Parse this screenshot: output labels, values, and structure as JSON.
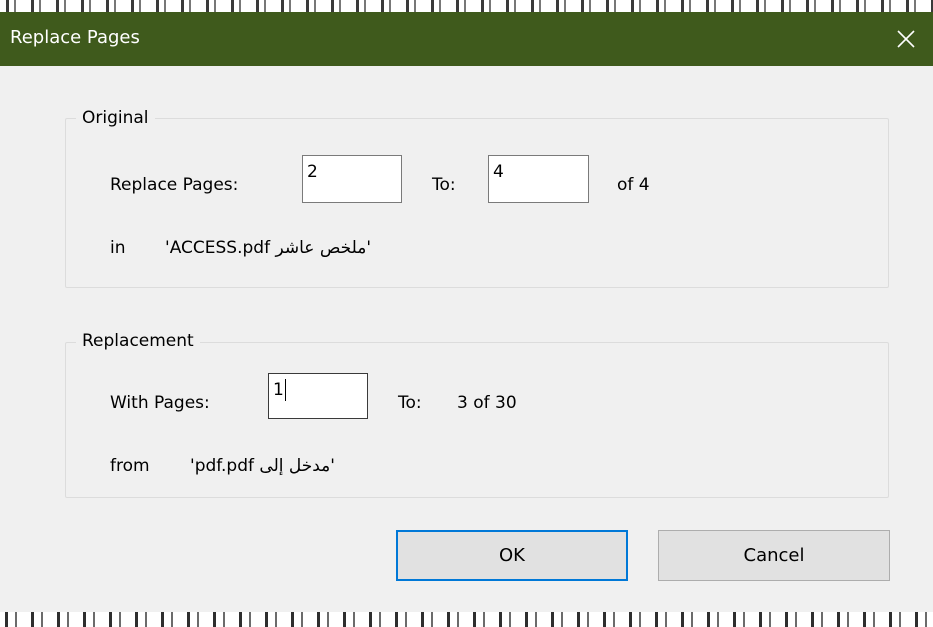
{
  "window": {
    "title": "Replace Pages",
    "close_label": "close"
  },
  "original": {
    "legend": "Original",
    "replace_pages_label": "Replace Pages:",
    "from_value": "2",
    "to_label": "To:",
    "to_value": "4",
    "of_text": "of 4",
    "in_label": "in",
    "filename": "'ملخص عاشر ACCESS.pdf'"
  },
  "replacement": {
    "legend": "Replacement",
    "with_pages_label": "With Pages:",
    "from_value": "1",
    "to_label": "To:",
    "to_text": "3 of 30",
    "from_label": "from",
    "filename": "'مدخل إلى pdf.pdf'"
  },
  "buttons": {
    "ok": "OK",
    "cancel": "Cancel"
  },
  "colors": {
    "titlebar": "#3f5a1c",
    "accent": "#0078d7",
    "dialog_bg": "#f0f0f0"
  }
}
